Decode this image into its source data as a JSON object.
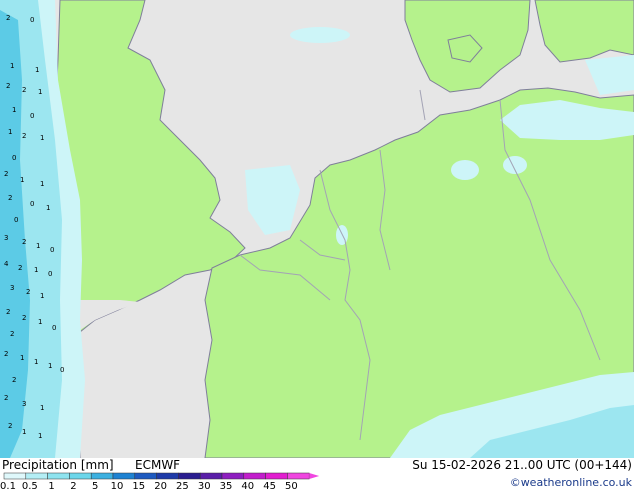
{
  "footer": {
    "title": "Precipitation [mm]",
    "model": "ECMWF",
    "valid_time": "Su 15-02-2026 21..00 UTC (00+144)",
    "credit": "©weatheronline.co.uk"
  },
  "legend": {
    "ticks": [
      "0.1",
      "0.5",
      "1",
      "2",
      "5",
      "10",
      "15",
      "20",
      "25",
      "30",
      "35",
      "40",
      "45",
      "50"
    ],
    "colors": [
      "#dff8fb",
      "#b4eef5",
      "#8ee3ef",
      "#6cd6ea",
      "#3cb0e0",
      "#1e82d2",
      "#1e5ac0",
      "#1e3aa8",
      "#2a1e90",
      "#5a1ea8",
      "#8e1ec0",
      "#c21ecc",
      "#e21ed0",
      "#f046e0"
    ]
  },
  "colors": {
    "land": "#b5f28c",
    "sea": "#e6e6e6",
    "border": "#a3a3b5",
    "coast": "#7f7f9a",
    "precip_light": "#cdf5f8",
    "precip_mid": "#9ce6f0",
    "precip_heavy": "#5ccbe6"
  },
  "point_values": [
    {
      "v": "2"
    },
    {
      "v": "0"
    },
    {
      "v": "1"
    },
    {
      "v": "1"
    },
    {
      "v": "2"
    },
    {
      "v": "2"
    },
    {
      "v": "1"
    },
    {
      "v": "1"
    },
    {
      "v": "0"
    },
    {
      "v": "1"
    },
    {
      "v": "2"
    },
    {
      "v": "1"
    },
    {
      "v": "0"
    },
    {
      "v": "2"
    },
    {
      "v": "1"
    },
    {
      "v": "1"
    },
    {
      "v": "2"
    },
    {
      "v": "0"
    },
    {
      "v": "1"
    },
    {
      "v": "0"
    },
    {
      "v": "3"
    },
    {
      "v": "2"
    },
    {
      "v": "1"
    },
    {
      "v": "0"
    },
    {
      "v": "4"
    },
    {
      "v": "2"
    },
    {
      "v": "1"
    },
    {
      "v": "0"
    },
    {
      "v": "3"
    },
    {
      "v": "2"
    },
    {
      "v": "1"
    },
    {
      "v": "2"
    },
    {
      "v": "2"
    },
    {
      "v": "1"
    },
    {
      "v": "0"
    },
    {
      "v": "2"
    },
    {
      "v": "2"
    },
    {
      "v": "1"
    },
    {
      "v": "1"
    },
    {
      "v": "1"
    },
    {
      "v": "0"
    },
    {
      "v": "2"
    },
    {
      "v": "2"
    },
    {
      "v": "3"
    },
    {
      "v": "1"
    },
    {
      "v": "2"
    },
    {
      "v": "1"
    },
    {
      "v": "1"
    }
  ]
}
